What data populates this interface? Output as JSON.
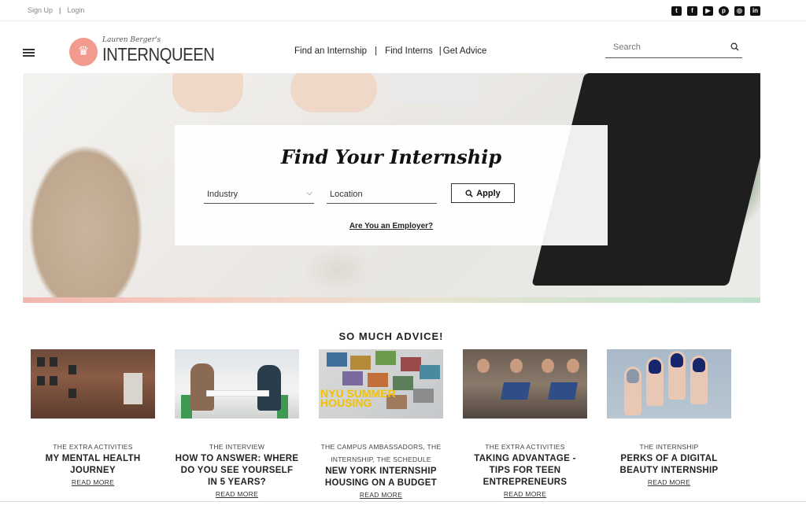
{
  "top_links": {
    "signup": "Sign Up",
    "login": "Login"
  },
  "social": [
    "twitter-icon",
    "facebook-icon",
    "youtube-icon",
    "pinterest-icon",
    "instagram-icon",
    "linkedin-icon"
  ],
  "logo": {
    "small": "Lauren Berger's",
    "big": "INTERNQUEEN"
  },
  "nav": {
    "find_internship": "Find an Internship",
    "find_interns": "Find Interns",
    "get_advice": "Get Advice"
  },
  "search": {
    "placeholder": "Search"
  },
  "hero": {
    "title": "Find Your Internship",
    "industry_label": "Industry",
    "location_placeholder": "Location",
    "apply_label": "Apply",
    "employer_link": "Are You an Employer?"
  },
  "advice": {
    "title": "SO MUCH ADVICE!",
    "cards": [
      {
        "category": "THE EXTRA ACTIVITIES",
        "headline": "MY MENTAL HEALTH JOURNEY",
        "read_more": "READ MORE"
      },
      {
        "category": "THE INTERVIEW",
        "headline": "HOW TO ANSWER: WHERE DO YOU SEE YOURSELF IN 5 YEARS?",
        "read_more": "READ MORE"
      },
      {
        "category": "THE CAMPUS AMBASSADORS, THE INTERNSHIP, THE SCHEDULE",
        "headline": "NEW YORK INTERNSHIP HOUSING ON A BUDGET",
        "read_more": "READ MORE"
      },
      {
        "category": "THE EXTRA ACTIVITIES",
        "headline": "TAKING ADVANTAGE - TIPS FOR TEEN ENTREPRENEURS",
        "read_more": "READ MORE"
      },
      {
        "category": "THE INTERNSHIP",
        "headline": "PERKS OF A DIGITAL BEAUTY INTERNSHIP",
        "read_more": "READ MORE"
      }
    ],
    "image_text": {
      "nyu": "NYU SUMMER HOUSING"
    }
  },
  "colors": {
    "brand_coral": "#f29a8e",
    "text_dark": "#222222"
  }
}
